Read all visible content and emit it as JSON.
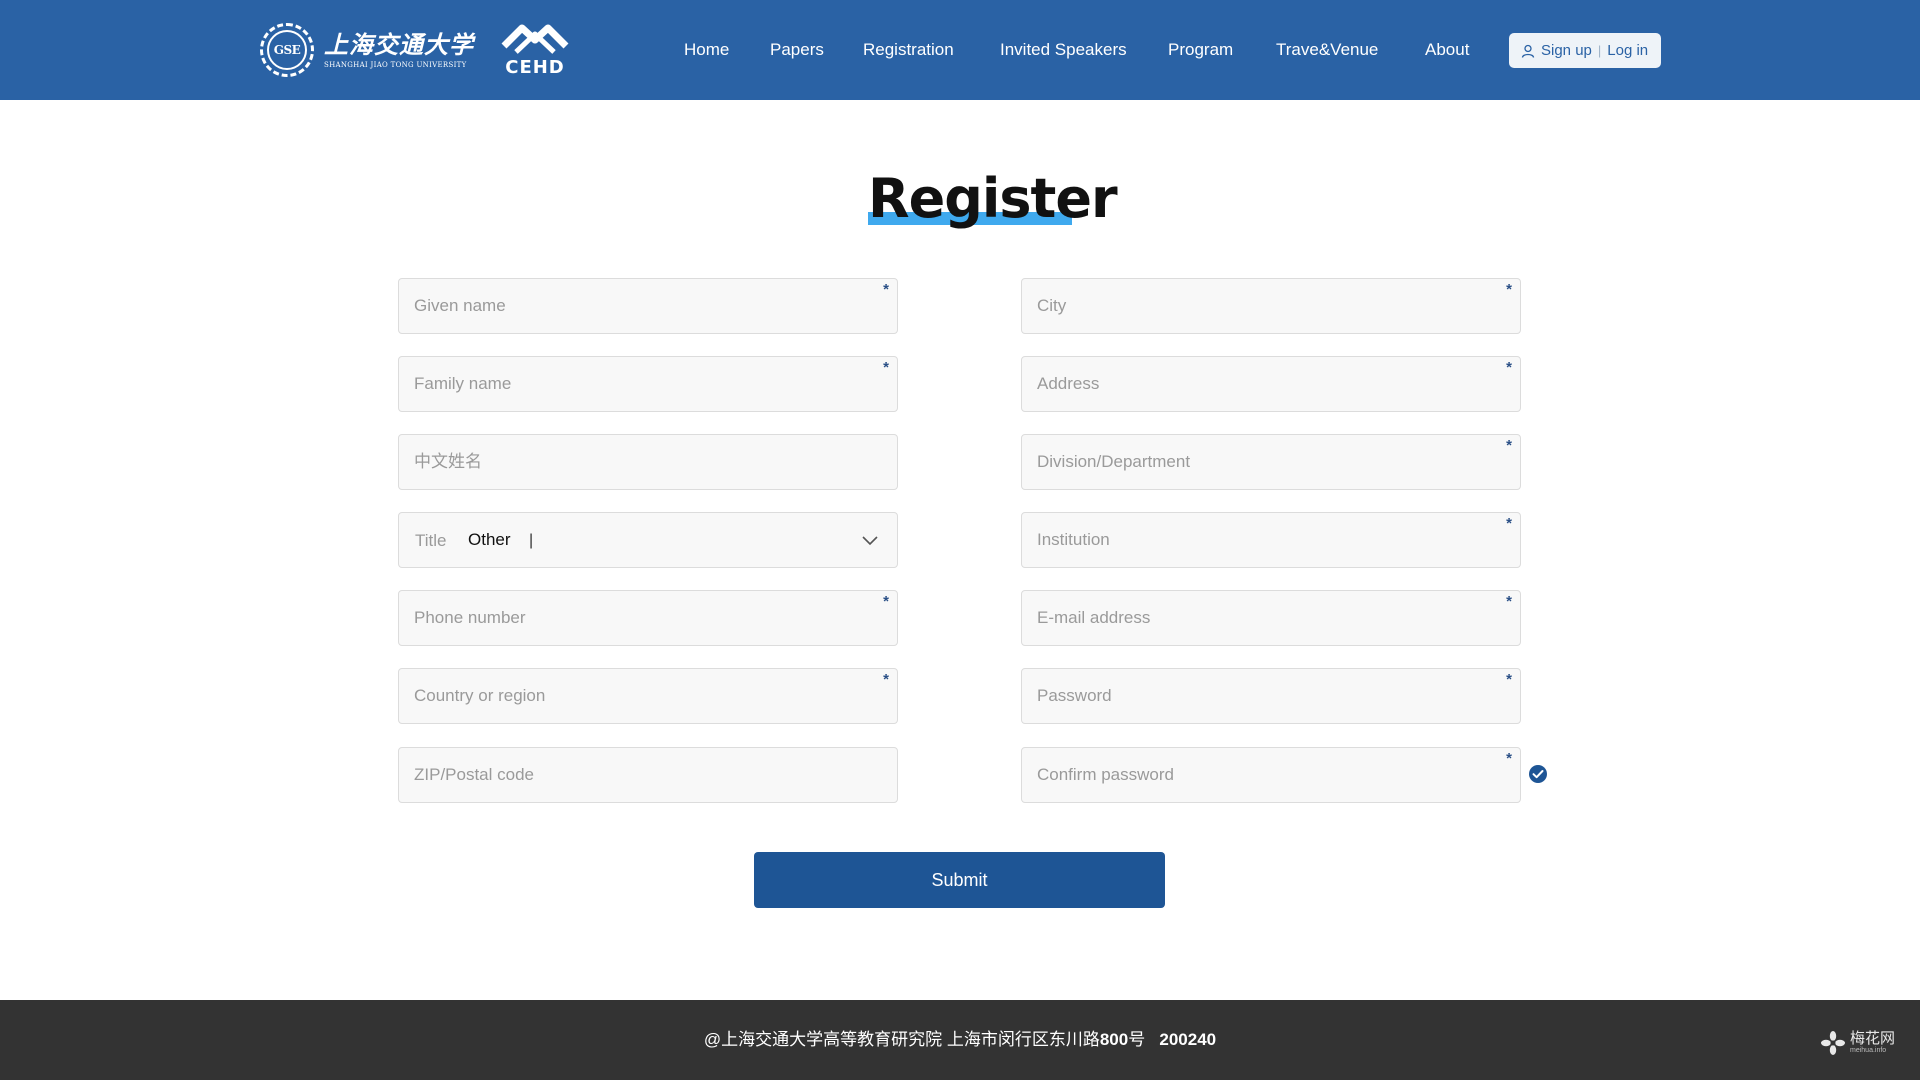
{
  "brand": {
    "seal_text": "GSE",
    "university_cn": "上海交通大学",
    "university_en": "SHANGHAI JIAO TONG UNIVERSITY",
    "org_logo_text": "CEHD"
  },
  "nav": {
    "items": [
      {
        "label": "Home"
      },
      {
        "label": "Papers"
      },
      {
        "label": "Registration"
      },
      {
        "label": "Invited Speakers"
      },
      {
        "label": "Program"
      },
      {
        "label": "Trave&Venue"
      },
      {
        "label": "About"
      }
    ],
    "signup_label": "Sign up",
    "separator": "|",
    "login_label": "Log in"
  },
  "page": {
    "title": "Register",
    "accent_color": "#3fa9ee",
    "header_color": "#2a62a5"
  },
  "form": {
    "required_mark": "*",
    "left": {
      "given_name": {
        "placeholder": "Given name",
        "value": ""
      },
      "family_name": {
        "placeholder": "Family name",
        "value": ""
      },
      "chinese_name": {
        "placeholder": "中文姓名",
        "value": ""
      },
      "title": {
        "label": "Title",
        "value": "Other",
        "caret": "|"
      },
      "phone": {
        "placeholder": "Phone number",
        "value": ""
      },
      "country": {
        "placeholder": "Country or region",
        "value": ""
      },
      "zip": {
        "placeholder": "ZIP/Postal code",
        "value": ""
      }
    },
    "right": {
      "city": {
        "placeholder": "City",
        "value": ""
      },
      "address": {
        "placeholder": "Address",
        "value": ""
      },
      "department": {
        "placeholder": "Division/Department",
        "value": ""
      },
      "institution": {
        "placeholder": "Institution",
        "value": ""
      },
      "email": {
        "placeholder": "E-mail address",
        "value": ""
      },
      "password": {
        "placeholder": "Password",
        "value": ""
      },
      "confirm_password": {
        "placeholder": "Confirm password",
        "value": ""
      }
    },
    "submit_label": "Submit"
  },
  "footer": {
    "address_prefix": "@上海交通大学高等教育研究院   上海市闵行区东川路",
    "number": "800",
    "suffix": "号",
    "postcode": "200240"
  },
  "watermark": {
    "cn": "梅花网",
    "en": "meihua.info"
  }
}
